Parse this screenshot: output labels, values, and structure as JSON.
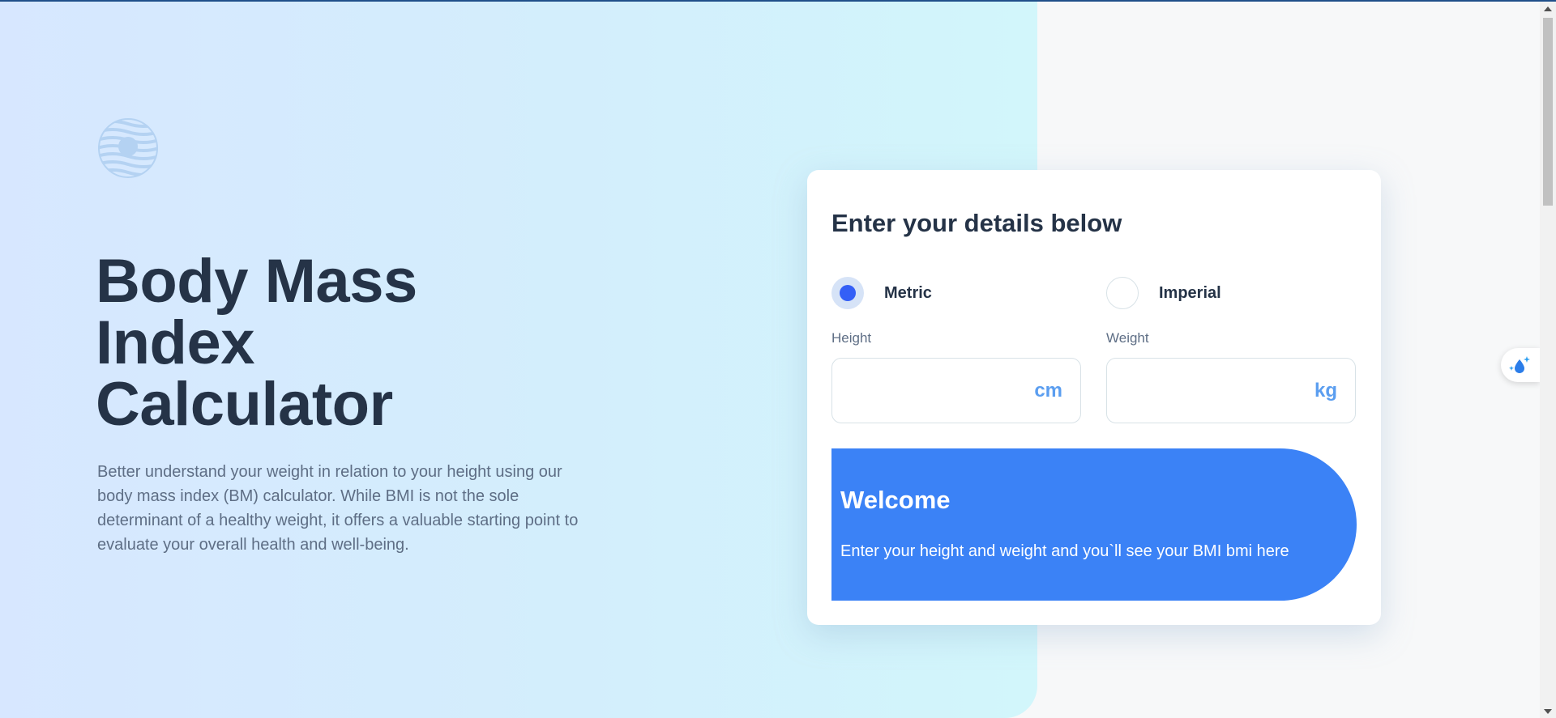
{
  "hero": {
    "logo_icon": "bmi-logo-icon",
    "title": "Body Mass Index Calculator",
    "description": "Better understand your weight in relation to your height using our body mass index (BM) calculator. While BMI is not the sole determinant of a healthy weight, it offers a valuable starting point to evaluate your overall health and well-being."
  },
  "form": {
    "title": "Enter your details below",
    "units": [
      {
        "label": "Metric",
        "selected": true
      },
      {
        "label": "Imperial",
        "selected": false
      }
    ],
    "height": {
      "label": "Height",
      "value": "",
      "unit": "cm"
    },
    "weight": {
      "label": "Weight",
      "value": "",
      "unit": "kg"
    }
  },
  "result": {
    "title": "Welcome",
    "text": "Enter your height and weight and you`ll see your BMI bmi here"
  },
  "widget": {
    "icon": "droplet-sparkle-icon"
  },
  "colors": {
    "primary": "#345ff6",
    "result_bg": "#3b82f6",
    "heading": "#253347",
    "body": "#5e6e85",
    "unit": "#5b9ef0"
  }
}
